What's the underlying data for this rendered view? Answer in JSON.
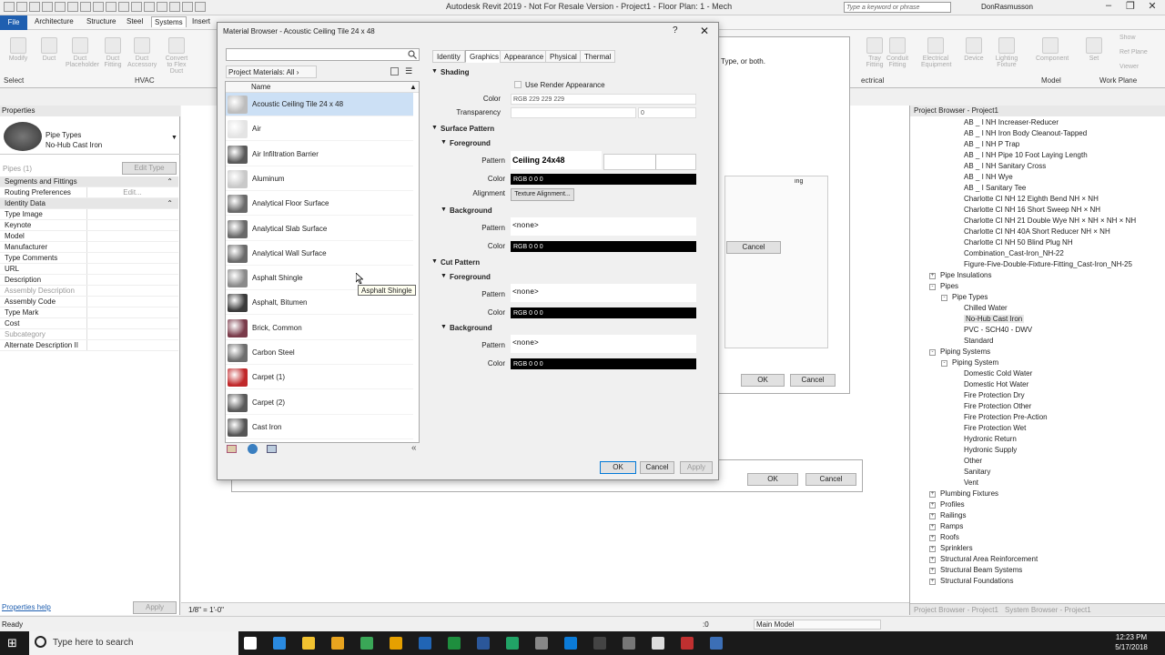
{
  "app": {
    "title": "Autodesk Revit 2019 - Not For Resale Version - Project1 - Floor Plan: 1 - Mech",
    "search_placeholder": "Type a keyword or phrase",
    "user": "DonRasmusson"
  },
  "tabs": [
    "File",
    "Architecture",
    "Structure",
    "Steel",
    "Systems",
    "Insert"
  ],
  "ribbon": {
    "buttons": [
      "Modify",
      "Duct",
      "Duct Placeholder",
      "Duct Fitting",
      "Duct Accessory",
      "Convert to Flex Duct"
    ],
    "right_buttons": [
      "Tray Fitting",
      "Conduit Fitting",
      "Electrical Equipment",
      "Device",
      "Lighting Fixture",
      "Component",
      "Set",
      "Show",
      "Ref Plane",
      "Viewer"
    ],
    "panels": [
      "Select",
      "HVAC",
      "ectrical",
      "Model",
      "Work Plane"
    ]
  },
  "properties": {
    "header": "Properties",
    "type_name": "Pipe Types",
    "type_value": "No-Hub Cast Iron",
    "instance_filter": "Pipes (1)",
    "edit_type": "Edit Type",
    "rows": [
      {
        "label": "Segments and Fittings",
        "section": true
      },
      {
        "label": "Routing Preferences",
        "value": "Edit..."
      },
      {
        "label": "Identity Data",
        "section": true
      },
      {
        "label": "Type Image"
      },
      {
        "label": "Keynote"
      },
      {
        "label": "Model"
      },
      {
        "label": "Manufacturer"
      },
      {
        "label": "Type Comments"
      },
      {
        "label": "URL"
      },
      {
        "label": "Description"
      },
      {
        "label": "Assembly Description",
        "grey": true
      },
      {
        "label": "Assembly Code"
      },
      {
        "label": "Type Mark"
      },
      {
        "label": "Cost"
      },
      {
        "label": "Subcategory",
        "grey": true
      },
      {
        "label": "Alternate Description II"
      }
    ],
    "help_link": "Properties help",
    "apply": "Apply"
  },
  "material_browser": {
    "title": "Material Browser - Acoustic Ceiling Tile 24 x 48",
    "filter_label": "Project Materials: All",
    "column_name": "Name",
    "materials": [
      {
        "name": "Acoustic Ceiling Tile 24 x 48",
        "swatch": "#bdbdbd",
        "selected": true
      },
      {
        "name": "Air",
        "swatch": "#e4e4e4"
      },
      {
        "name": "Air Infiltration Barrier",
        "swatch": "#5a5a5a"
      },
      {
        "name": "Aluminum",
        "swatch": "#c9c9c9"
      },
      {
        "name": "Analytical Floor Surface",
        "swatch": "#6a6a6a"
      },
      {
        "name": "Analytical Slab Surface",
        "swatch": "#6a6a6a"
      },
      {
        "name": "Analytical Wall Surface",
        "swatch": "#6a6a6a"
      },
      {
        "name": "Asphalt Shingle",
        "swatch": "#8a8a8a"
      },
      {
        "name": "Asphalt, Bitumen",
        "swatch": "#3b3b3b"
      },
      {
        "name": "Brick, Common",
        "swatch": "#7a3b4a"
      },
      {
        "name": "Carbon Steel",
        "swatch": "#6e6e6e"
      },
      {
        "name": "Carpet (1)",
        "swatch": "#c0282a"
      },
      {
        "name": "Carpet (2)",
        "swatch": "#5a5a5a"
      },
      {
        "name": "Cast Iron",
        "swatch": "#555555"
      }
    ],
    "tooltip": "Asphalt Shingle",
    "tabs": [
      "Identity",
      "Graphics",
      "Appearance",
      "Physical",
      "Thermal"
    ],
    "active_tab": "Graphics",
    "shading": {
      "header": "Shading",
      "use_render": "Use Render Appearance",
      "color_label": "Color",
      "color_value": "RGB 229 229 229",
      "transparency_label": "Transparency",
      "transparency_value": "0"
    },
    "surface_pattern": {
      "header": "Surface Pattern",
      "foreground": "Foreground",
      "pattern_label": "Pattern",
      "pattern_value": "Ceiling 24x48",
      "color_label": "Color",
      "color_value": "RGB 0 0 0",
      "alignment_label": "Alignment",
      "alignment_value": "Texture Alignment...",
      "background": "Background",
      "bg_pattern_value": "<none>",
      "bg_color_value": "RGB 0 0 0"
    },
    "cut_pattern": {
      "header": "Cut Pattern",
      "foreground": "Foreground",
      "fg_pattern_value": "<none>",
      "fg_color_value": "RGB 0 0 0",
      "background": "Background",
      "bg_pattern_value": "<none>",
      "bg_color_value": "RGB 0 0 0"
    },
    "buttons": {
      "ok": "OK",
      "cancel": "Cancel",
      "apply": "Apply"
    }
  },
  "back_dialog": {
    "hint": "Type, or both.",
    "column": "ing",
    "cancel": "Cancel",
    "ok": "OK",
    "cancel2": "Cancel",
    "ok3": "OK",
    "cancel3": "Cancel"
  },
  "project_browser": {
    "header": "Project Browser - Project1",
    "items": [
      {
        "text": "AB _ I NH Increaser-Reducer",
        "indent": 3
      },
      {
        "text": "AB _ I NH Iron Body Cleanout-Tapped",
        "indent": 3
      },
      {
        "text": "AB _ I NH P Trap",
        "indent": 3
      },
      {
        "text": "AB _ I NH Pipe 10 Foot Laying Length",
        "indent": 3
      },
      {
        "text": "AB _ I NH Sanitary Cross",
        "indent": 3
      },
      {
        "text": "AB _ I NH Wye",
        "indent": 3
      },
      {
        "text": "AB _ I Sanitary Tee",
        "indent": 3
      },
      {
        "text": "Charlotte CI NH 12 Eighth Bend NH × NH",
        "indent": 3
      },
      {
        "text": "Charlotte CI NH 16 Short Sweep NH × NH",
        "indent": 3
      },
      {
        "text": "Charlotte CI NH 21 Double Wye NH × NH × NH × NH",
        "indent": 3
      },
      {
        "text": "Charlotte CI NH 40A Short Reducer NH × NH",
        "indent": 3
      },
      {
        "text": "Charlotte CI NH 50 Blind Plug NH",
        "indent": 3
      },
      {
        "text": "Combination_Cast-Iron_NH-22",
        "indent": 3
      },
      {
        "text": "Figure-Five-Double-Fixture-Fitting_Cast-Iron_NH-25",
        "indent": 3
      },
      {
        "text": "Pipe Insulations",
        "indent": 1,
        "toggle": "+"
      },
      {
        "text": "Pipes",
        "indent": 1,
        "toggle": "-"
      },
      {
        "text": "Pipe Types",
        "indent": 2,
        "toggle": "-"
      },
      {
        "text": "Chilled Water",
        "indent": 3
      },
      {
        "text": "No-Hub Cast Iron",
        "indent": 3,
        "selected": true
      },
      {
        "text": "PVC - SCH40 - DWV",
        "indent": 3
      },
      {
        "text": "Standard",
        "indent": 3
      },
      {
        "text": "Piping Systems",
        "indent": 1,
        "toggle": "-"
      },
      {
        "text": "Piping System",
        "indent": 2,
        "toggle": "-"
      },
      {
        "text": "Domestic Cold Water",
        "indent": 3
      },
      {
        "text": "Domestic Hot Water",
        "indent": 3
      },
      {
        "text": "Fire Protection Dry",
        "indent": 3
      },
      {
        "text": "Fire Protection Other",
        "indent": 3
      },
      {
        "text": "Fire Protection Pre-Action",
        "indent": 3
      },
      {
        "text": "Fire Protection Wet",
        "indent": 3
      },
      {
        "text": "Hydronic Return",
        "indent": 3
      },
      {
        "text": "Hydronic Supply",
        "indent": 3
      },
      {
        "text": "Other",
        "indent": 3
      },
      {
        "text": "Sanitary",
        "indent": 3
      },
      {
        "text": "Vent",
        "indent": 3
      },
      {
        "text": "Plumbing Fixtures",
        "indent": 1,
        "toggle": "+"
      },
      {
        "text": "Profiles",
        "indent": 1,
        "toggle": "+"
      },
      {
        "text": "Railings",
        "indent": 1,
        "toggle": "+"
      },
      {
        "text": "Ramps",
        "indent": 1,
        "toggle": "+"
      },
      {
        "text": "Roofs",
        "indent": 1,
        "toggle": "+"
      },
      {
        "text": "Sprinklers",
        "indent": 1,
        "toggle": "+"
      },
      {
        "text": "Structural Area Reinforcement",
        "indent": 1,
        "toggle": "+"
      },
      {
        "text": "Structural Beam Systems",
        "indent": 1,
        "toggle": "+"
      },
      {
        "text": "Structural Foundations",
        "indent": 1,
        "toggle": "+"
      }
    ],
    "footer_tabs": [
      "Project Browser - Project1",
      "System Browser - Project1"
    ]
  },
  "view_bar": {
    "scale": "1/8\" = 1'-0\""
  },
  "status": {
    "text": "Ready",
    "zero": ":0",
    "model": "Main Model"
  },
  "taskbar": {
    "search": "Type here to search",
    "time": "12:23 PM",
    "date": "5/17/2018"
  },
  "colors": {
    "accent": "#1f5fb0",
    "selection": "#cce0f5",
    "taskbar": "#1a1a1a"
  }
}
